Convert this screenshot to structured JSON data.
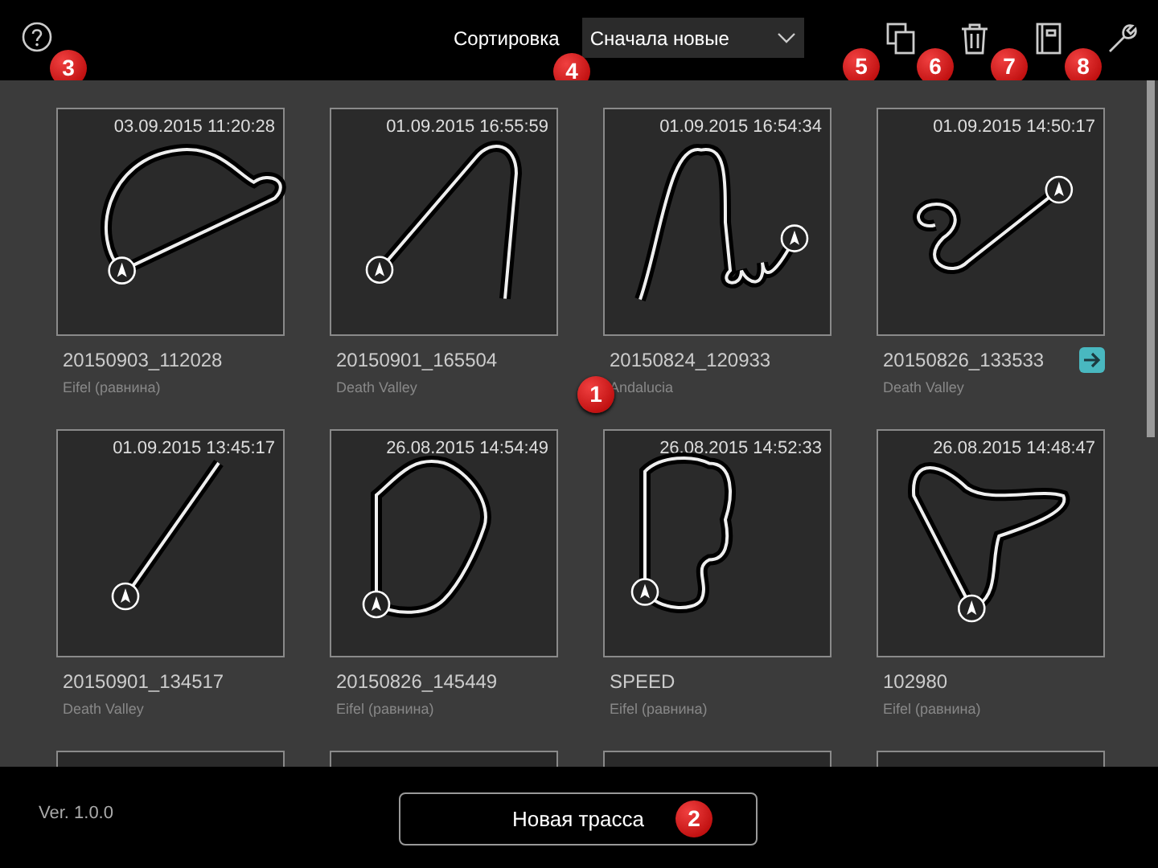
{
  "header": {
    "help": {
      "callout": "3"
    },
    "sort": {
      "label": "Сортировка",
      "value": "Сначала новые",
      "callout": "4"
    },
    "tools": [
      {
        "kind": "copy",
        "callout": "5"
      },
      {
        "kind": "trash",
        "callout": "6"
      },
      {
        "kind": "notebook",
        "callout": "7"
      },
      {
        "kind": "wrench",
        "callout": "8"
      }
    ]
  },
  "grid": {
    "callout": "1",
    "tracks": [
      {
        "date": "03.09.2015 11:20:28",
        "name": "20150903_112028",
        "location": "Eifel (равнина)",
        "shared": false
      },
      {
        "date": "01.09.2015 16:55:59",
        "name": "20150901_165504",
        "location": "Death Valley",
        "shared": false
      },
      {
        "date": "01.09.2015 16:54:34",
        "name": "20150824_120933",
        "location": "Andalucia",
        "shared": false
      },
      {
        "date": "01.09.2015 14:50:17",
        "name": "20150826_133533",
        "location": "Death Valley",
        "shared": true
      },
      {
        "date": "01.09.2015 13:45:17",
        "name": "20150901_134517",
        "location": "Death Valley",
        "shared": false
      },
      {
        "date": "26.08.2015 14:54:49",
        "name": "20150826_145449",
        "location": "Eifel (равнина)",
        "shared": false
      },
      {
        "date": "26.08.2015 14:52:33",
        "name": "SPEED",
        "location": "Eifel (равнина)",
        "shared": false
      },
      {
        "date": "26.08.2015 14:48:47",
        "name": "102980",
        "location": "Eifel (равнина)",
        "shared": false
      }
    ]
  },
  "footer": {
    "version": "Ver. 1.0.0",
    "new_track": {
      "label": "Новая трасса",
      "callout": "2"
    }
  }
}
